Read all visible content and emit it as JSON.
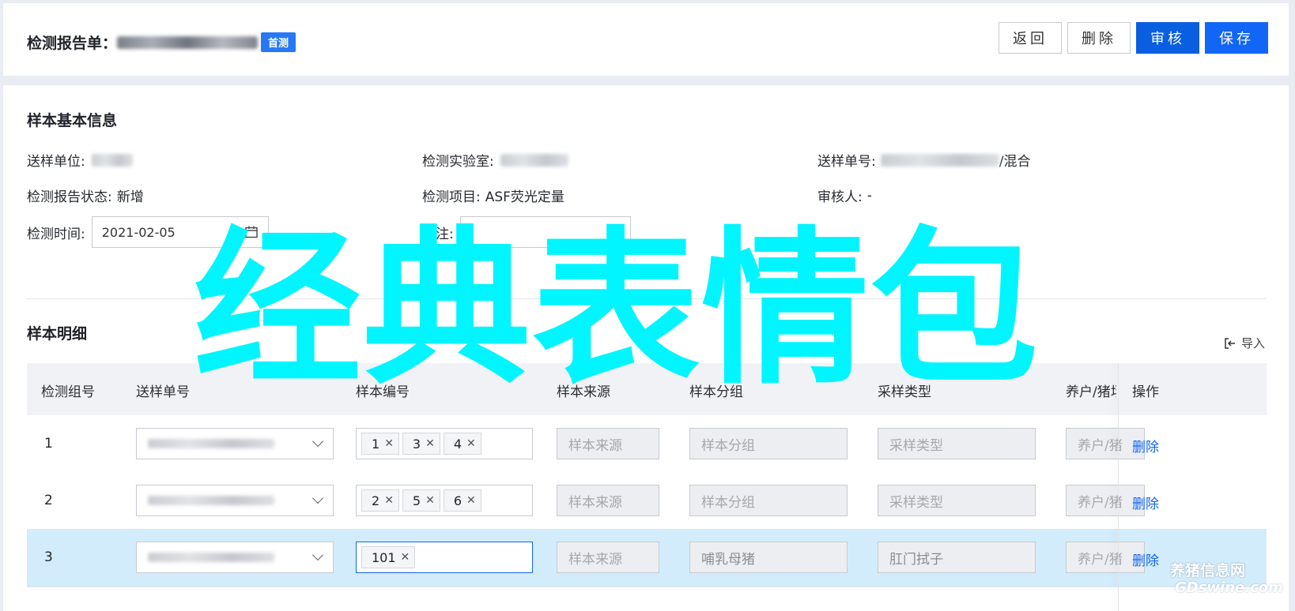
{
  "header": {
    "title": "检测报告单：",
    "tag": "首测",
    "buttons": {
      "back": "返回",
      "delete": "删除",
      "review": "审核",
      "save": "保存"
    }
  },
  "basic": {
    "section_title": "样本基本信息",
    "send_unit_label": "送样单位:",
    "lab_label": "检测实验室:",
    "send_no_label": "送样单号:",
    "send_no_suffix": "/混合",
    "status_label": "检测报告状态:",
    "status_value": "新增",
    "item_label": "检测项目:",
    "item_value": "ASF荧光定量",
    "reviewer_label": "审核人:",
    "reviewer_value": "-",
    "time_label": "检测时间:",
    "time_value": "2021-02-05",
    "remark_label": "备注:"
  },
  "detail": {
    "section_title": "样本明细",
    "import_label": "导入",
    "columns": [
      "检测组号",
      "送样单号",
      "样本编号",
      "样本来源",
      "样本分组",
      "采样类型",
      "养户/猪场",
      "操作"
    ],
    "source_placeholder": "样本来源",
    "group_placeholder": "样本分组",
    "type_placeholder": "采样类型",
    "farm_placeholder": "养户/猪",
    "delete_label": "删除",
    "rows": [
      {
        "group": "1",
        "samples": [
          "1",
          "3",
          "4"
        ],
        "group_value": "",
        "type_value": ""
      },
      {
        "group": "2",
        "samples": [
          "2",
          "5",
          "6"
        ],
        "group_value": "",
        "type_value": ""
      },
      {
        "group": "3",
        "samples": [
          "101"
        ],
        "group_value": "哺乳母猪",
        "type_value": "肛门拭子"
      }
    ]
  },
  "watermark": {
    "text": "经典表情包",
    "corner": "养猪信息网",
    "corner_sub": "GDswine.com"
  },
  "colors": {
    "primary": "#1166f5",
    "highlight_row": "#d3ecfc",
    "watermark": "#00f5ff"
  }
}
